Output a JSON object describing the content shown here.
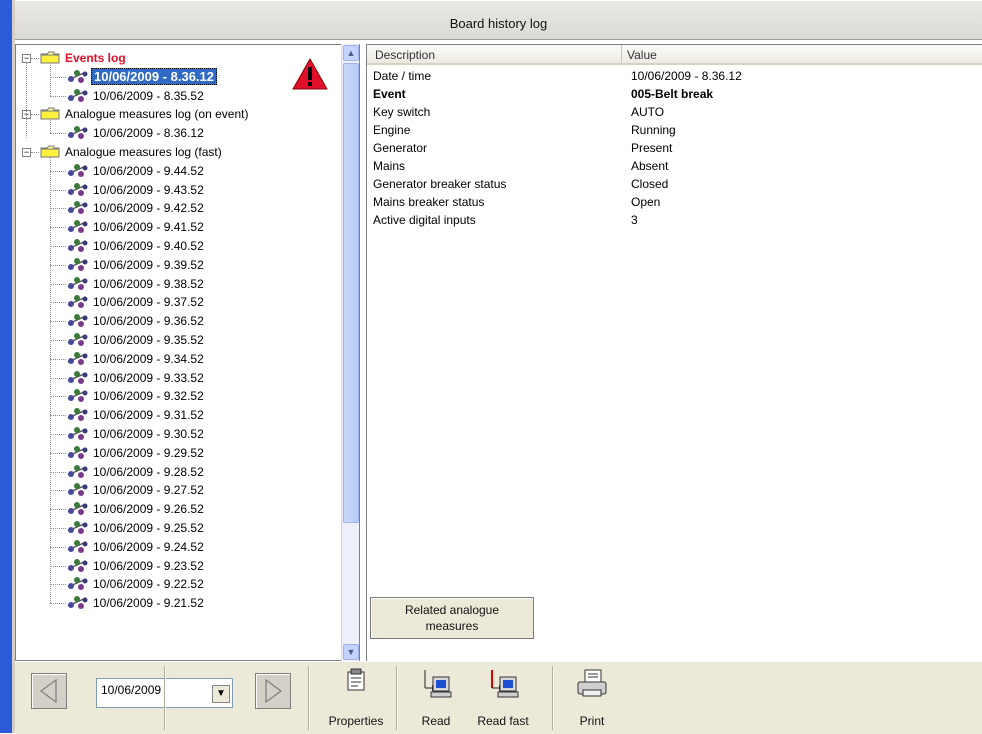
{
  "window": {
    "title": "Board history log"
  },
  "tree": {
    "events_log": {
      "label": "Events log",
      "items": [
        "10/06/2009 - 8.36.12",
        "10/06/2009 - 8.35.52"
      ]
    },
    "analogue_on_event": {
      "label": "Analogue measures log (on event)",
      "items": [
        "10/06/2009 - 8.36.12"
      ]
    },
    "analogue_fast": {
      "label": "Analogue measures log (fast)",
      "items": [
        "10/06/2009 - 9.44.52",
        "10/06/2009 - 9.43.52",
        "10/06/2009 - 9.42.52",
        "10/06/2009 - 9.41.52",
        "10/06/2009 - 9.40.52",
        "10/06/2009 - 9.39.52",
        "10/06/2009 - 9.38.52",
        "10/06/2009 - 9.37.52",
        "10/06/2009 - 9.36.52",
        "10/06/2009 - 9.35.52",
        "10/06/2009 - 9.34.52",
        "10/06/2009 - 9.33.52",
        "10/06/2009 - 9.32.52",
        "10/06/2009 - 9.31.52",
        "10/06/2009 - 9.30.52",
        "10/06/2009 - 9.29.52",
        "10/06/2009 - 9.28.52",
        "10/06/2009 - 9.27.52",
        "10/06/2009 - 9.26.52",
        "10/06/2009 - 9.25.52",
        "10/06/2009 - 9.24.52",
        "10/06/2009 - 9.23.52",
        "10/06/2009 - 9.22.52",
        "10/06/2009 - 9.21.52"
      ]
    },
    "selected": "10/06/2009 - 8.36.12",
    "alert_icon": "warning-triangle-icon"
  },
  "details": {
    "columns": [
      "Description",
      "Value"
    ],
    "rows": [
      {
        "desc": "Date / time",
        "value": "10/06/2009 - 8.36.12",
        "bold": false
      },
      {
        "desc": "Event",
        "value": "005-Belt break",
        "bold": true
      },
      {
        "desc": "Key switch",
        "value": "AUTO",
        "bold": false
      },
      {
        "desc": "Engine",
        "value": "Running",
        "bold": false
      },
      {
        "desc": "Generator",
        "value": "Present",
        "bold": false
      },
      {
        "desc": "Mains",
        "value": "Absent",
        "bold": false
      },
      {
        "desc": "Generator breaker status",
        "value": "Closed",
        "bold": false
      },
      {
        "desc": "Mains breaker status",
        "value": "Open",
        "bold": false
      },
      {
        "desc": "Active digital inputs",
        "value": "3",
        "bold": false
      }
    ],
    "related_button": {
      "line1": "Related analogue",
      "line2": "measures"
    }
  },
  "toolbar": {
    "date_value": "10/06/2009",
    "properties": "Properties",
    "read": "Read",
    "read_fast": "Read fast",
    "print": "Print"
  },
  "colors": {
    "accent_blue": "#316ac5",
    "alert_red": "#e0102a",
    "window_border": "#2c5bd7"
  }
}
